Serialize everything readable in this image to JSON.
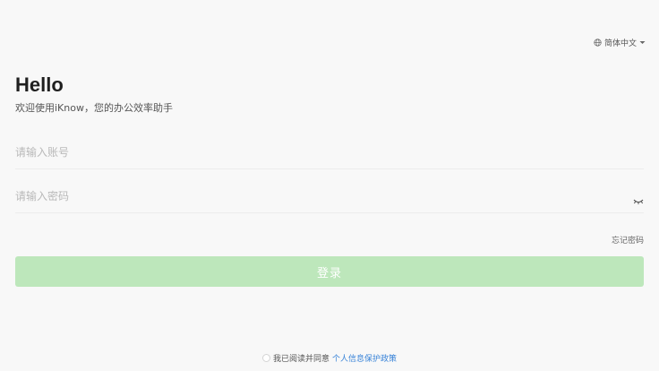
{
  "header": {
    "language_label": "简体中文",
    "language_icon": "globe-icon",
    "dropdown_icon": "caret-down-icon"
  },
  "intro": {
    "title": "Hello",
    "subtitle": "欢迎使用iKnow，您的办公效率助手"
  },
  "form": {
    "account_placeholder": "请输入账号",
    "account_value": "",
    "password_placeholder": "请输入密码",
    "password_value": "",
    "password_toggle_icon": "eye-closed-icon",
    "forgot_label": "忘记密码",
    "login_label": "登录"
  },
  "footer": {
    "agreement_prefix": "我已阅读并同意",
    "agreement_link": "个人信息保护政策"
  },
  "colors": {
    "background": "#f8f8f8",
    "primary_disabled": "#bde7bb",
    "link": "#3a84d8"
  }
}
